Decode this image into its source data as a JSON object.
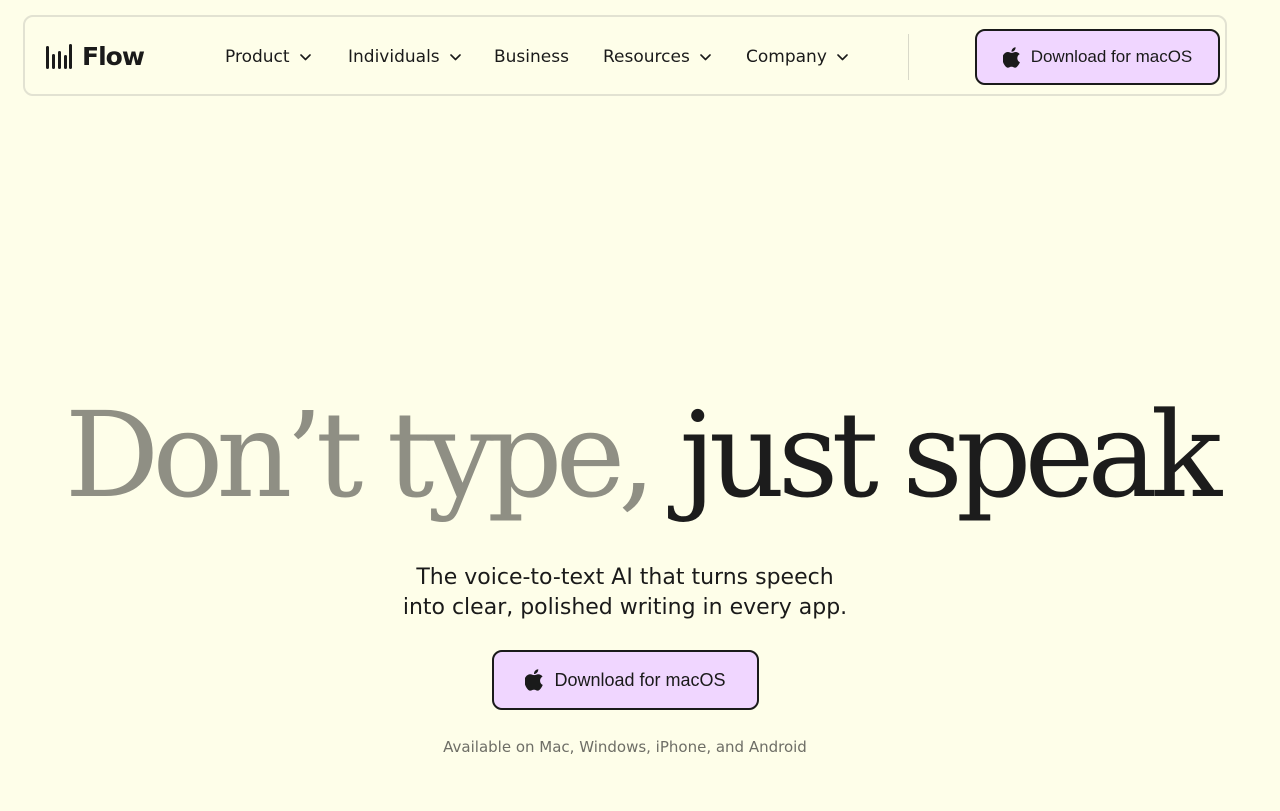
{
  "brand": {
    "name": "Flow",
    "logo_icon": "sound-bars-icon"
  },
  "nav": {
    "items": [
      {
        "label": "Product",
        "has_dropdown": true
      },
      {
        "label": "Individuals",
        "has_dropdown": true
      },
      {
        "label": "Business",
        "has_dropdown": false
      },
      {
        "label": "Resources",
        "has_dropdown": true
      },
      {
        "label": "Company",
        "has_dropdown": true
      }
    ],
    "cta_label": "Download for macOS",
    "cta_icon": "apple-icon"
  },
  "hero": {
    "title_muted": "Don’t type,",
    "title_strong": "just speak",
    "subtitle_line1": "The voice-to-text AI that turns speech",
    "subtitle_line2": "into clear, polished writing in every app.",
    "cta_label": "Download for macOS",
    "availability": "Available on Mac, Windows, iPhone, and Android"
  },
  "colors": {
    "background": "#fefee9",
    "button_fill": "#f0d6ff",
    "button_border": "#1a1a1a",
    "title_muted": "#8f8f84",
    "title_strong": "#1c1c1c",
    "secondary_text": "#6e6e66"
  }
}
